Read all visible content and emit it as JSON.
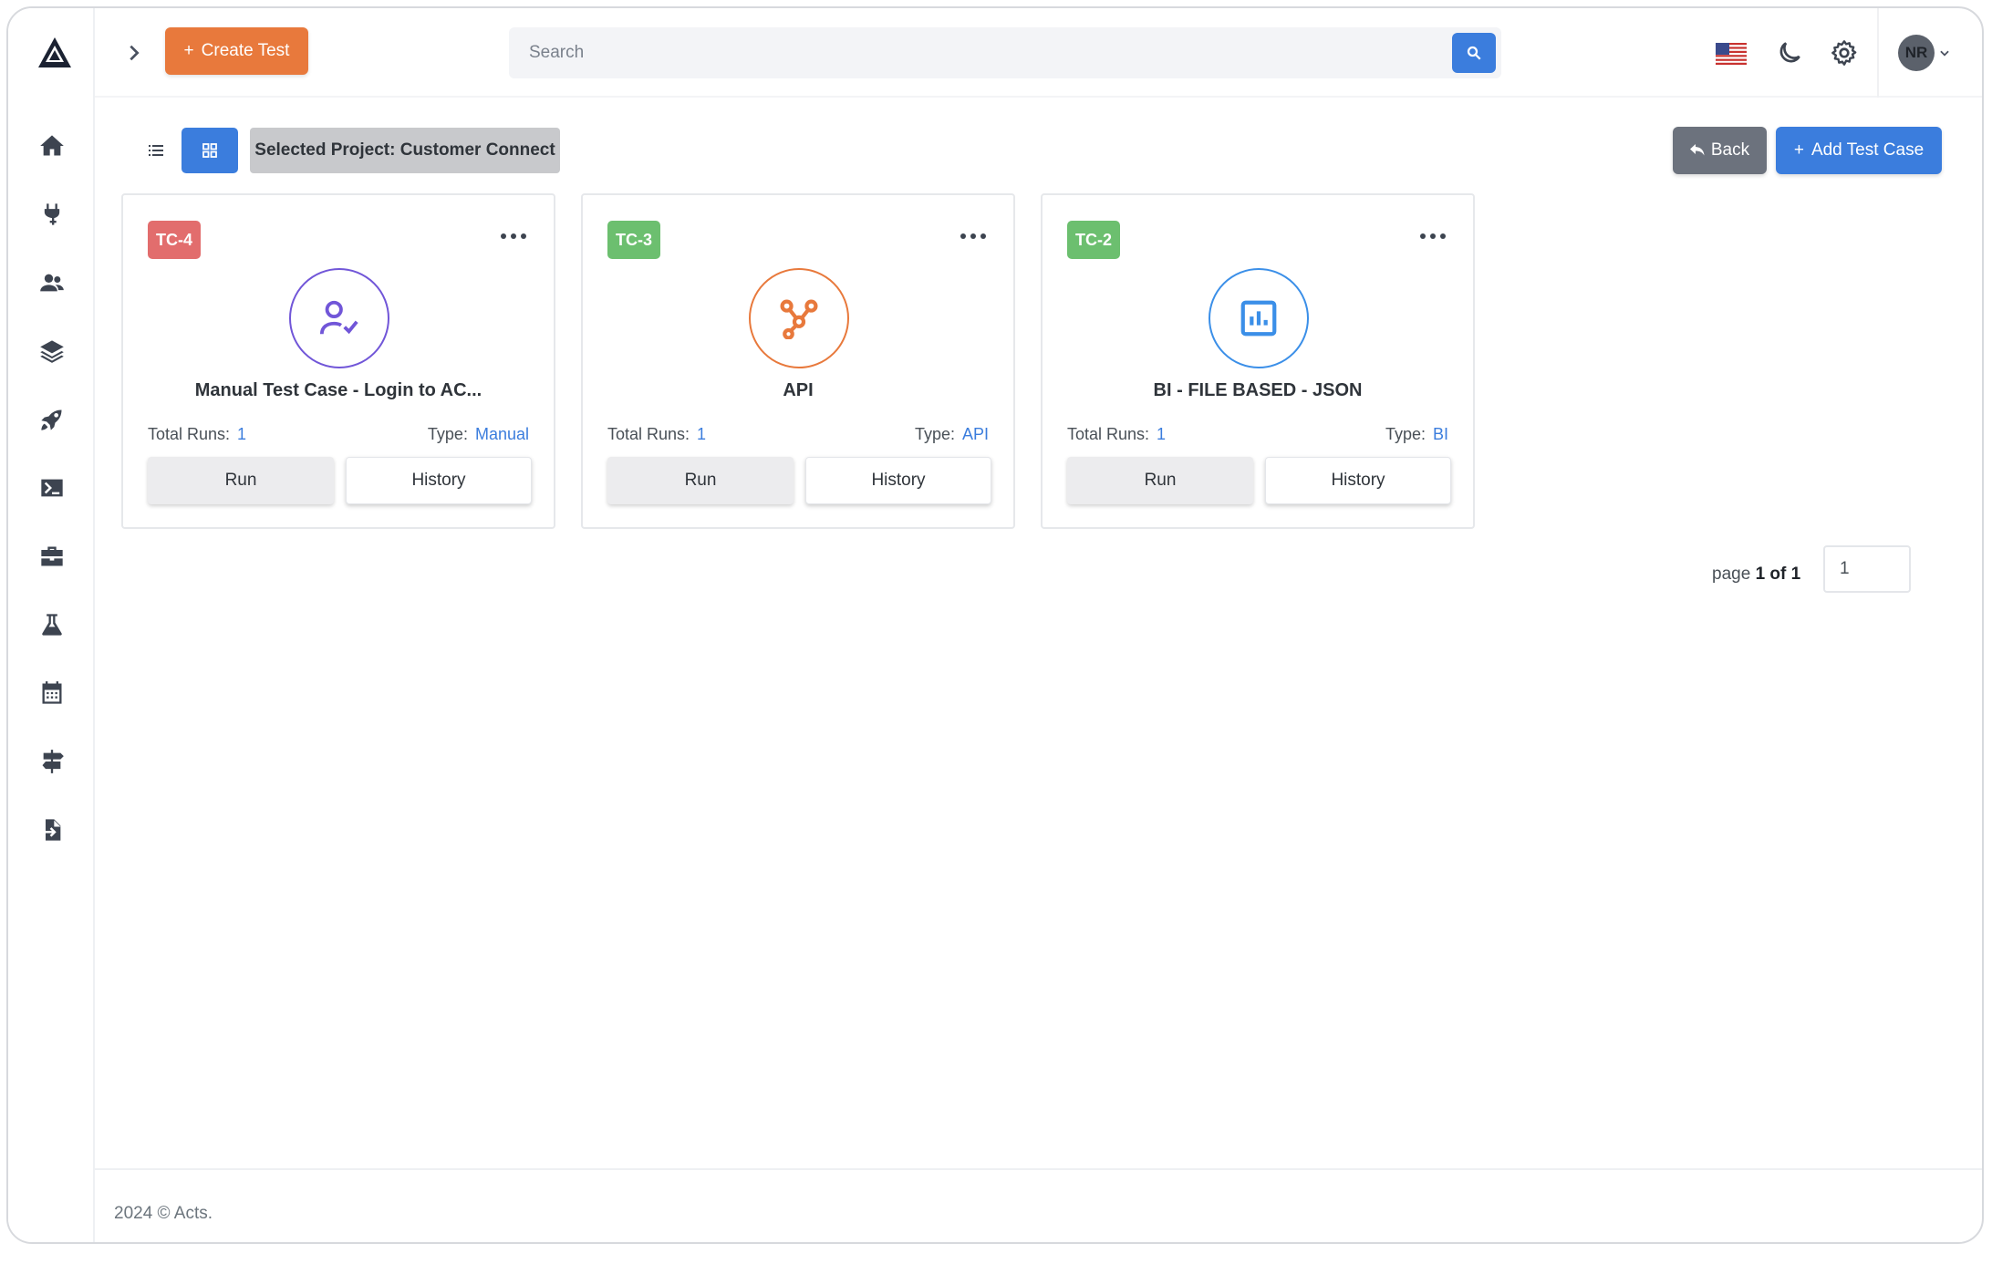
{
  "topbar": {
    "create_label": "Create Test",
    "search_placeholder": "Search",
    "avatar_initials": "NR"
  },
  "sidebar": {
    "items": [
      {
        "icon": "home-icon"
      },
      {
        "icon": "plug-icon"
      },
      {
        "icon": "users-icon"
      },
      {
        "icon": "layers-icon"
      },
      {
        "icon": "rocket-icon"
      },
      {
        "icon": "terminal-icon"
      },
      {
        "icon": "briefcase-icon"
      },
      {
        "icon": "flask-icon"
      },
      {
        "icon": "calendar-icon"
      },
      {
        "icon": "signpost-icon"
      },
      {
        "icon": "file-import-icon"
      }
    ]
  },
  "toolbar": {
    "project_label": "Selected Project: Customer Connect",
    "back_label": "Back",
    "add_label": "Add Test Case"
  },
  "cards": [
    {
      "id": "TC-4",
      "id_color": "#e26d6d",
      "title": "Manual Test Case - Login to AC...",
      "icon": "user-check-icon",
      "icon_color": "#7156d8",
      "runs_label": "Total Runs:",
      "runs": "1",
      "type_label": "Type:",
      "type": "Manual",
      "run_label": "Run",
      "history_label": "History"
    },
    {
      "id": "TC-3",
      "id_color": "#6cbf6f",
      "title": "API",
      "icon": "share-nodes-icon",
      "icon_color": "#e8793c",
      "runs_label": "Total Runs:",
      "runs": "1",
      "type_label": "Type:",
      "type": "API",
      "run_label": "Run",
      "history_label": "History"
    },
    {
      "id": "TC-2",
      "id_color": "#6cbf6f",
      "title": "BI - FILE BASED - JSON",
      "icon": "bar-chart-icon",
      "icon_color": "#3b8fe8",
      "runs_label": "Total Runs:",
      "runs": "1",
      "type_label": "Type:",
      "type": "BI",
      "run_label": "Run",
      "history_label": "History"
    }
  ],
  "pagination": {
    "page_prefix": "page",
    "page_info": "1 of 1",
    "page_value": "1"
  },
  "footer": {
    "text": "2024 © Acts."
  },
  "colors": {
    "accent": "#3b7ddd",
    "create": "#e8793c",
    "back": "#6c727d"
  }
}
